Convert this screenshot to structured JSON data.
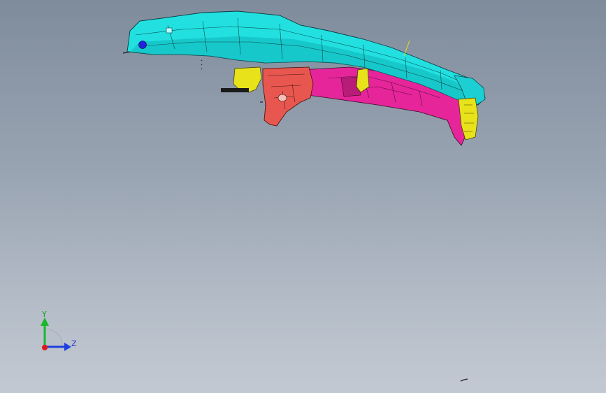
{
  "viewport": {
    "background_top": "#7f8c9c",
    "background_bottom": "#c3c9d2"
  },
  "model": {
    "name_icon": "car-body-assembly-model",
    "colors": {
      "roof_rail": "#22e0e0",
      "roof_rail_dark": "#0fb5b8",
      "inner_panel": "#e6259a",
      "front_pillar": "#e8574f",
      "brackets": "#e8e21a",
      "edges": "#1a1a1a",
      "hole": "#2222dd"
    }
  },
  "triad": {
    "y_label": "Y",
    "z_label": "Z",
    "x_color": "#e01818",
    "y_color": "#19b82c",
    "z_color": "#1f3fe0"
  }
}
